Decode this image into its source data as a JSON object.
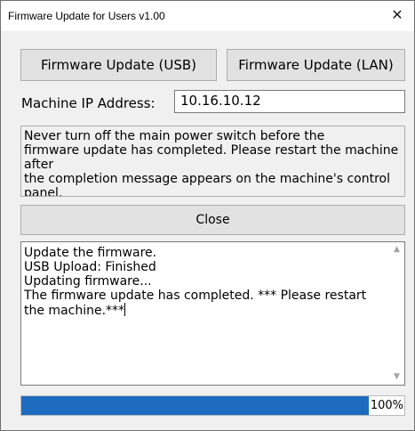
{
  "window": {
    "title": "Firmware Update for Users v1.00",
    "close_glyph": "✕"
  },
  "buttons": {
    "usb_label": "Firmware Update (USB)",
    "lan_label": "Firmware Update (LAN)",
    "close_label": "Close"
  },
  "ip": {
    "label": "Machine IP Address:",
    "value": "10.16.10.12"
  },
  "warning": {
    "text": "Never turn off the main power switch before the\nfirmware update has completed. Please restart the machine after\nthe completion message appears on the machine's control panel."
  },
  "log": {
    "text": "Update the firmware.\nUSB Upload: Finished\nUpdating firmware...\nThe firmware update has completed. *** Please restart the machine.***",
    "scroll_up_glyph": "▲",
    "scroll_down_glyph": "▼"
  },
  "progress": {
    "percent": 100,
    "label": "100%"
  },
  "colors": {
    "progress_fill": "#1c6bbf",
    "window_bg": "#f0f0f0"
  }
}
